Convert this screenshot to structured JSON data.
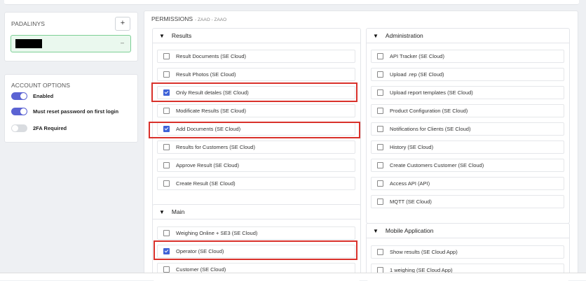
{
  "padalinys": {
    "title": "PADALINYS",
    "add_label": "+",
    "field_value": "–"
  },
  "account_options": {
    "title": "ACCOUNT OPTIONS",
    "toggles": [
      {
        "label": "Enabled",
        "on": true
      },
      {
        "label": "Must reset password on first login",
        "on": true
      },
      {
        "label": "2FA Required",
        "on": false
      }
    ]
  },
  "permissions": {
    "title": "PERMISSIONS",
    "subtitle": "- ZAAO - ZAAO",
    "groups": {
      "results": {
        "title": "Results",
        "items": [
          {
            "label": "Result Documents (SE Cloud)",
            "checked": false
          },
          {
            "label": "Result Photos (SE Cloud)",
            "checked": false
          },
          {
            "label": "Only Result detales (SE Cloud)",
            "checked": true
          },
          {
            "label": "Modificate Results (SE Cloud)",
            "checked": false
          },
          {
            "label": "Add Documents (SE Cloud)",
            "checked": true
          },
          {
            "label": "Results for Customers (SE Cloud)",
            "checked": false
          },
          {
            "label": "Approve Result (SE Cloud)",
            "checked": false
          },
          {
            "label": "Create Result (SE Cloud)",
            "checked": false
          }
        ]
      },
      "main": {
        "title": "Main",
        "items": [
          {
            "label": "Weighing Online + SE3 (SE Cloud)",
            "checked": false
          },
          {
            "label": "Operator (SE Cloud)",
            "checked": true
          },
          {
            "label": "Customer (SE Cloud)",
            "checked": false
          }
        ]
      },
      "administration": {
        "title": "Administration",
        "items": [
          {
            "label": "API Tracker (SE Cloud)",
            "checked": false
          },
          {
            "label": "Upload .rep (SE Cloud)",
            "checked": false
          },
          {
            "label": "Upload report templates (SE Cloud)",
            "checked": false
          },
          {
            "label": "Product Configuration (SE Cloud)",
            "checked": false
          },
          {
            "label": "Notifications for Clients (SE Cloud)",
            "checked": false
          },
          {
            "label": "History (SE Cloud)",
            "checked": false
          },
          {
            "label": "Create Customers Customer (SE Cloud)",
            "checked": false
          },
          {
            "label": "Access API (API)",
            "checked": false
          },
          {
            "label": "MQTT (SE Cloud)",
            "checked": false
          }
        ]
      },
      "mobile": {
        "title": "Mobile Application",
        "items": [
          {
            "label": "Show results (SE Cloud App)",
            "checked": false
          },
          {
            "label": "1 weighing (SE Cloud App)",
            "checked": false
          }
        ]
      }
    }
  },
  "colors": {
    "accent": "#5b63d3",
    "checkbox": "#3f63d8",
    "highlight": "#d9312b",
    "field_bg": "#eaf8ee",
    "field_border": "#7ccf95"
  }
}
